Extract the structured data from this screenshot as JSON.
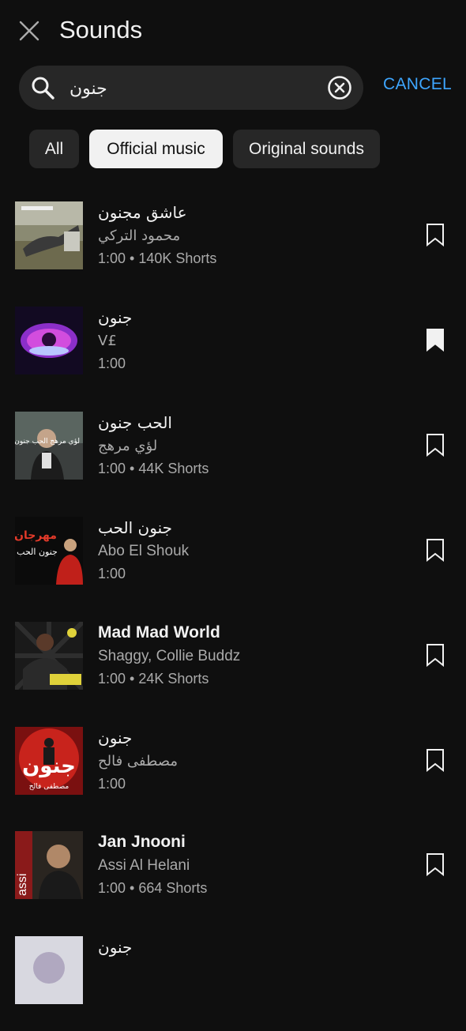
{
  "header": {
    "title": "Sounds"
  },
  "search": {
    "value": "جنون",
    "cancel_label": "CANCEL"
  },
  "chips": [
    {
      "label": "All",
      "active": false
    },
    {
      "label": "Official music",
      "active": true
    },
    {
      "label": "Original sounds",
      "active": false
    }
  ],
  "results": [
    {
      "title": "عاشق مجنون",
      "artist": "محمود التركي",
      "meta": "1:00 • 140K Shorts",
      "saved": false
    },
    {
      "title": "جنون",
      "artist": "V£",
      "meta": "1:00",
      "saved": true
    },
    {
      "title": "الحب جنون",
      "artist": "لؤي مرهج",
      "meta": "1:00 • 44K Shorts",
      "saved": false
    },
    {
      "title": "جنون الحب",
      "artist": "Abo El Shouk",
      "meta": "1:00",
      "saved": false
    },
    {
      "title": "Mad Mad World",
      "artist": "Shaggy, Collie Buddz",
      "meta": "1:00 • 24K Shorts",
      "saved": false
    },
    {
      "title": "جنون",
      "artist": "مصطفى فالح",
      "meta": "1:00",
      "saved": false
    },
    {
      "title": "Jan Jnooni",
      "artist": "Assi Al Helani",
      "meta": "1:00 • 664 Shorts",
      "saved": false
    },
    {
      "title": "جنون",
      "artist": "",
      "meta": "",
      "saved": false
    }
  ],
  "thumb_text": {
    "r3": "لؤي مرهج الحب جنون",
    "r4_top": "مهرجان",
    "r4_bottom": "جنون الحب",
    "r6_big": "جنون",
    "r6_small": "مصطفى فالح",
    "r7": "assi"
  },
  "colors": {
    "accent": "#3ea6ff",
    "background": "#0f0f0f",
    "chip_bg": "#272727"
  }
}
